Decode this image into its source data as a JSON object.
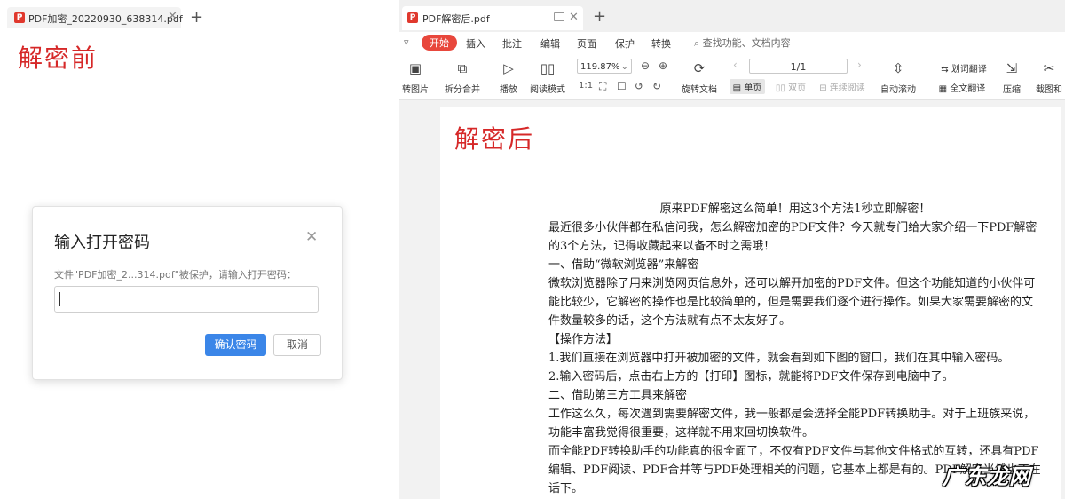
{
  "left": {
    "tab": {
      "filename": "PDF加密_20220930_638314.pdf"
    },
    "heading": "解密前",
    "dialog": {
      "title": "输入打开密码",
      "message": "文件\"PDF加密_2...314.pdf\"被保护，请输入打开密码：",
      "input_value": "",
      "confirm_label": "确认密码",
      "cancel_label": "取消"
    }
  },
  "right": {
    "tab": {
      "filename": "PDF解密后.pdf"
    },
    "menu": {
      "items": [
        "插入",
        "批注",
        "编辑",
        "页面",
        "保护",
        "转换"
      ],
      "active": "开始",
      "search_placeholder": "查找功能、文档内容"
    },
    "toolbar": {
      "tools": {
        "to_image": "转图片",
        "split_merge": "拆分合并",
        "play": "播放",
        "read_mode": "阅读模式",
        "rotate": "旋转文档",
        "single": "单页",
        "double": "双页",
        "continuous": "连续阅读",
        "auto_scroll": "自动滚动",
        "word_translate": "划词翻译",
        "full_translate": "全文翻译",
        "compress": "压缩",
        "screenshot": "截图和"
      },
      "zoom": "119.87%",
      "page": "1/1"
    },
    "document": {
      "heading": "解密后",
      "title_line": "原来PDF解密这么简单！用这3个方法1秒立即解密！",
      "paragraphs": [
        "最近很多小伙伴都在私信问我，怎么解密加密的PDF文件？今天就专门给大家介绍一下PDF解密的3个方法，记得收藏起来以备不时之需哦！",
        "一、借助“微软浏览器”来解密",
        "微软浏览器除了用来浏览网页信息外，还可以解开加密的PDF文件。但这个功能知道的小伙伴可能比较少，它解密的操作也是比较简单的，但是需要我们逐个进行操作。如果大家需要解密的文件数量较多的话，这个方法就有点不太友好了。",
        "【操作方法】",
        "1.我们直接在浏览器中打开被加密的文件，就会看到如下图的窗口，我们在其中输入密码。",
        "2.输入密码后，点击右上方的【打印】图标，就能将PDF文件保存到电脑中了。",
        "二、借助第三方工具来解密",
        "工作这么久，每次遇到需要解密文件，我一般都是会选择全能PDF转换助手。对于上班族来说，功能丰富我觉得很重要，这样就不用来回切换软件。",
        "而全能PDF转换助手的功能真的很全面了，不仅有PDF文件与其他文件格式的互转，还具有PDF编辑、PDF阅读、PDF合并等与PDF处理相关的问题，它基本上都是有的。PDF解密当然也不在话下。"
      ]
    }
  },
  "watermark": "广东龙网",
  "colors": {
    "accent_red": "#d62828",
    "primary_blue": "#3b86e8"
  }
}
